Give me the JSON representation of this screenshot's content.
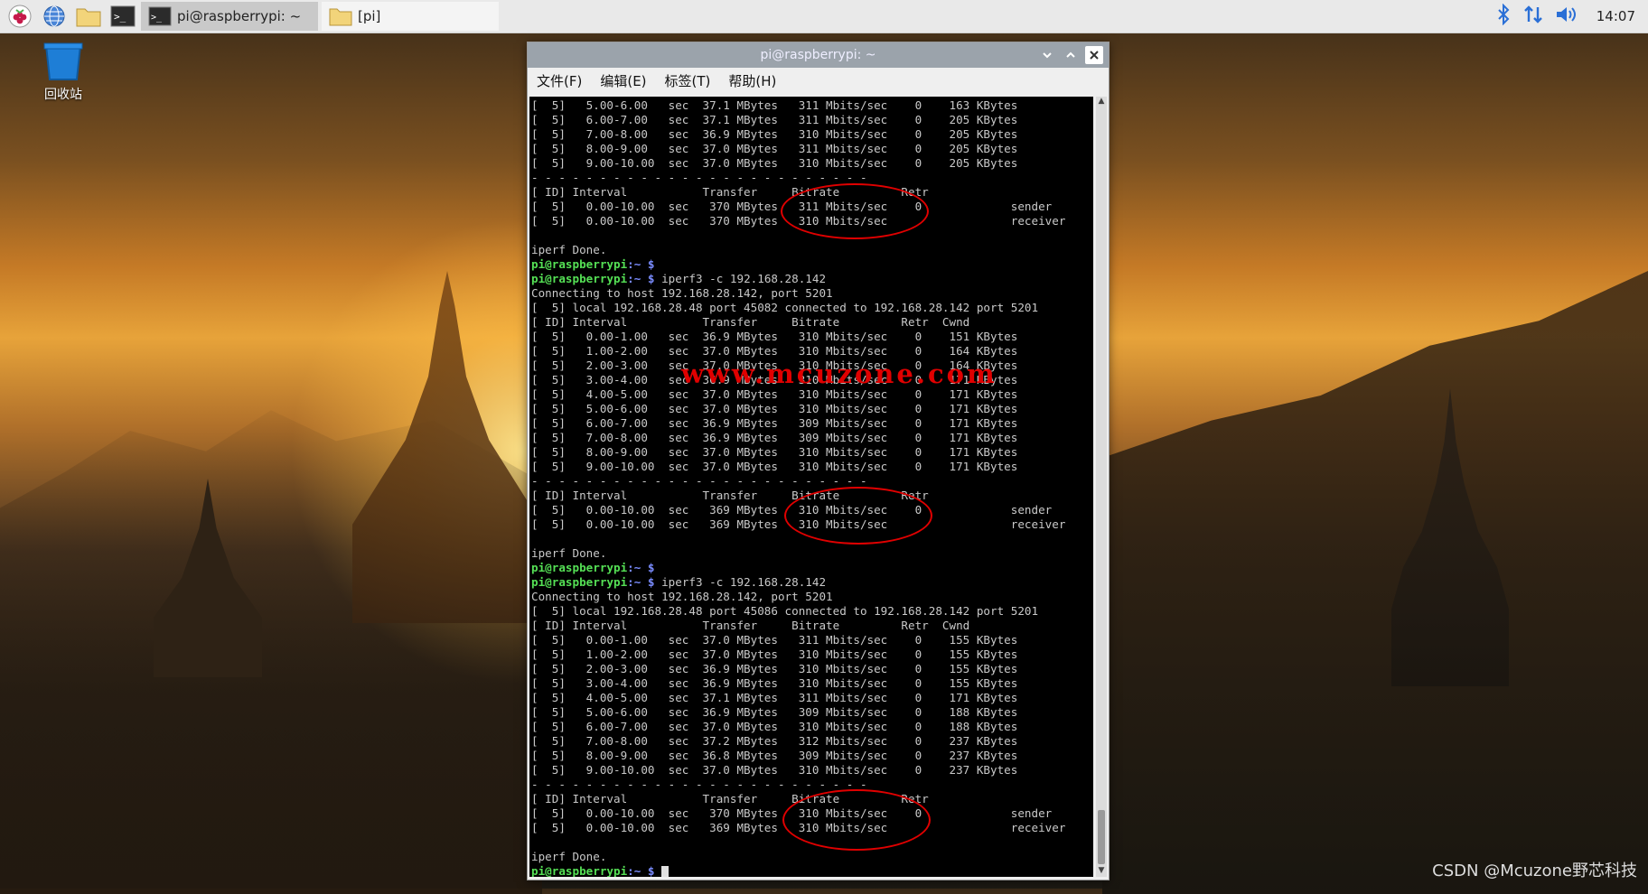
{
  "taskbar": {
    "tasks": [
      {
        "label": "pi@raspberrypi: ~",
        "state": "active"
      },
      {
        "label": "[pi]",
        "state": "inactive"
      }
    ],
    "clock": "14:07",
    "icons": [
      "raspberry-menu-icon",
      "browser-icon",
      "file-manager-icon",
      "terminal-icon",
      "bluetooth-icon",
      "network-icon",
      "volume-icon"
    ]
  },
  "desktop": {
    "trash_label": "回收站"
  },
  "window": {
    "title": "pi@raspberrypi: ~",
    "menus": [
      "文件(F)",
      "编辑(E)",
      "标签(T)",
      "帮助(H)"
    ]
  },
  "terminal": {
    "lines": [
      "[  5]   5.00-6.00   sec  37.1 MBytes   311 Mbits/sec    0    163 KBytes",
      "[  5]   6.00-7.00   sec  37.1 MBytes   311 Mbits/sec    0    205 KBytes",
      "[  5]   7.00-8.00   sec  36.9 MBytes   310 Mbits/sec    0    205 KBytes",
      "[  5]   8.00-9.00   sec  37.0 MBytes   311 Mbits/sec    0    205 KBytes",
      "[  5]   9.00-10.00  sec  37.0 MBytes   310 Mbits/sec    0    205 KBytes",
      "- - - - - - - - - - - - - - - - - - - - - - - - -",
      "[ ID] Interval           Transfer     Bitrate         Retr",
      "[  5]   0.00-10.00  sec   370 MBytes   311 Mbits/sec    0             sender",
      "[  5]   0.00-10.00  sec   370 MBytes   310 Mbits/sec                  receiver",
      "",
      "iperf Done.",
      {
        "prompt": "pi@raspberrypi",
        "path": ":~ $",
        "cmd": ""
      },
      {
        "prompt": "pi@raspberrypi",
        "path": ":~ $",
        "cmd": " iperf3 -c 192.168.28.142"
      },
      "Connecting to host 192.168.28.142, port 5201",
      "[  5] local 192.168.28.48 port 45082 connected to 192.168.28.142 port 5201",
      "[ ID] Interval           Transfer     Bitrate         Retr  Cwnd",
      "[  5]   0.00-1.00   sec  36.9 MBytes   310 Mbits/sec    0    151 KBytes",
      "[  5]   1.00-2.00   sec  37.0 MBytes   310 Mbits/sec    0    164 KBytes",
      "[  5]   2.00-3.00   sec  37.0 MBytes   310 Mbits/sec    0    164 KBytes",
      "[  5]   3.00-4.00   sec  36.9 MBytes   310 Mbits/sec    0    171 KBytes",
      "[  5]   4.00-5.00   sec  37.0 MBytes   310 Mbits/sec    0    171 KBytes",
      "[  5]   5.00-6.00   sec  37.0 MBytes   310 Mbits/sec    0    171 KBytes",
      "[  5]   6.00-7.00   sec  36.9 MBytes   309 Mbits/sec    0    171 KBytes",
      "[  5]   7.00-8.00   sec  36.9 MBytes   309 Mbits/sec    0    171 KBytes",
      "[  5]   8.00-9.00   sec  37.0 MBytes   310 Mbits/sec    0    171 KBytes",
      "[  5]   9.00-10.00  sec  37.0 MBytes   310 Mbits/sec    0    171 KBytes",
      "- - - - - - - - - - - - - - - - - - - - - - - - -",
      "[ ID] Interval           Transfer     Bitrate         Retr",
      "[  5]   0.00-10.00  sec   369 MBytes   310 Mbits/sec    0             sender",
      "[  5]   0.00-10.00  sec   369 MBytes   310 Mbits/sec                  receiver",
      "",
      "iperf Done.",
      {
        "prompt": "pi@raspberrypi",
        "path": ":~ $",
        "cmd": ""
      },
      {
        "prompt": "pi@raspberrypi",
        "path": ":~ $",
        "cmd": " iperf3 -c 192.168.28.142"
      },
      "Connecting to host 192.168.28.142, port 5201",
      "[  5] local 192.168.28.48 port 45086 connected to 192.168.28.142 port 5201",
      "[ ID] Interval           Transfer     Bitrate         Retr  Cwnd",
      "[  5]   0.00-1.00   sec  37.0 MBytes   311 Mbits/sec    0    155 KBytes",
      "[  5]   1.00-2.00   sec  37.0 MBytes   310 Mbits/sec    0    155 KBytes",
      "[  5]   2.00-3.00   sec  36.9 MBytes   310 Mbits/sec    0    155 KBytes",
      "[  5]   3.00-4.00   sec  36.9 MBytes   310 Mbits/sec    0    155 KBytes",
      "[  5]   4.00-5.00   sec  37.1 MBytes   311 Mbits/sec    0    171 KBytes",
      "[  5]   5.00-6.00   sec  36.9 MBytes   309 Mbits/sec    0    188 KBytes",
      "[  5]   6.00-7.00   sec  37.0 MBytes   310 Mbits/sec    0    188 KBytes",
      "[  5]   7.00-8.00   sec  37.2 MBytes   312 Mbits/sec    0    237 KBytes",
      "[  5]   8.00-9.00   sec  36.8 MBytes   309 Mbits/sec    0    237 KBytes",
      "[  5]   9.00-10.00  sec  37.0 MBytes   310 Mbits/sec    0    237 KBytes",
      "- - - - - - - - - - - - - - - - - - - - - - - - -",
      "[ ID] Interval           Transfer     Bitrate         Retr",
      "[  5]   0.00-10.00  sec   370 MBytes   310 Mbits/sec    0             sender",
      "[  5]   0.00-10.00  sec   369 MBytes   310 Mbits/sec                  receiver",
      "",
      "iperf Done.",
      {
        "prompt": "pi@raspberrypi",
        "path": ":~ $",
        "cmd": " ",
        "cursor": true
      }
    ]
  },
  "overlay": {
    "watermark": "www.mcuzone.com",
    "credit": "CSDN @Mcuzone野芯科技"
  },
  "colors": {
    "annotation": "#e00000",
    "prompt": "#55e055",
    "path": "#7a8cff"
  }
}
